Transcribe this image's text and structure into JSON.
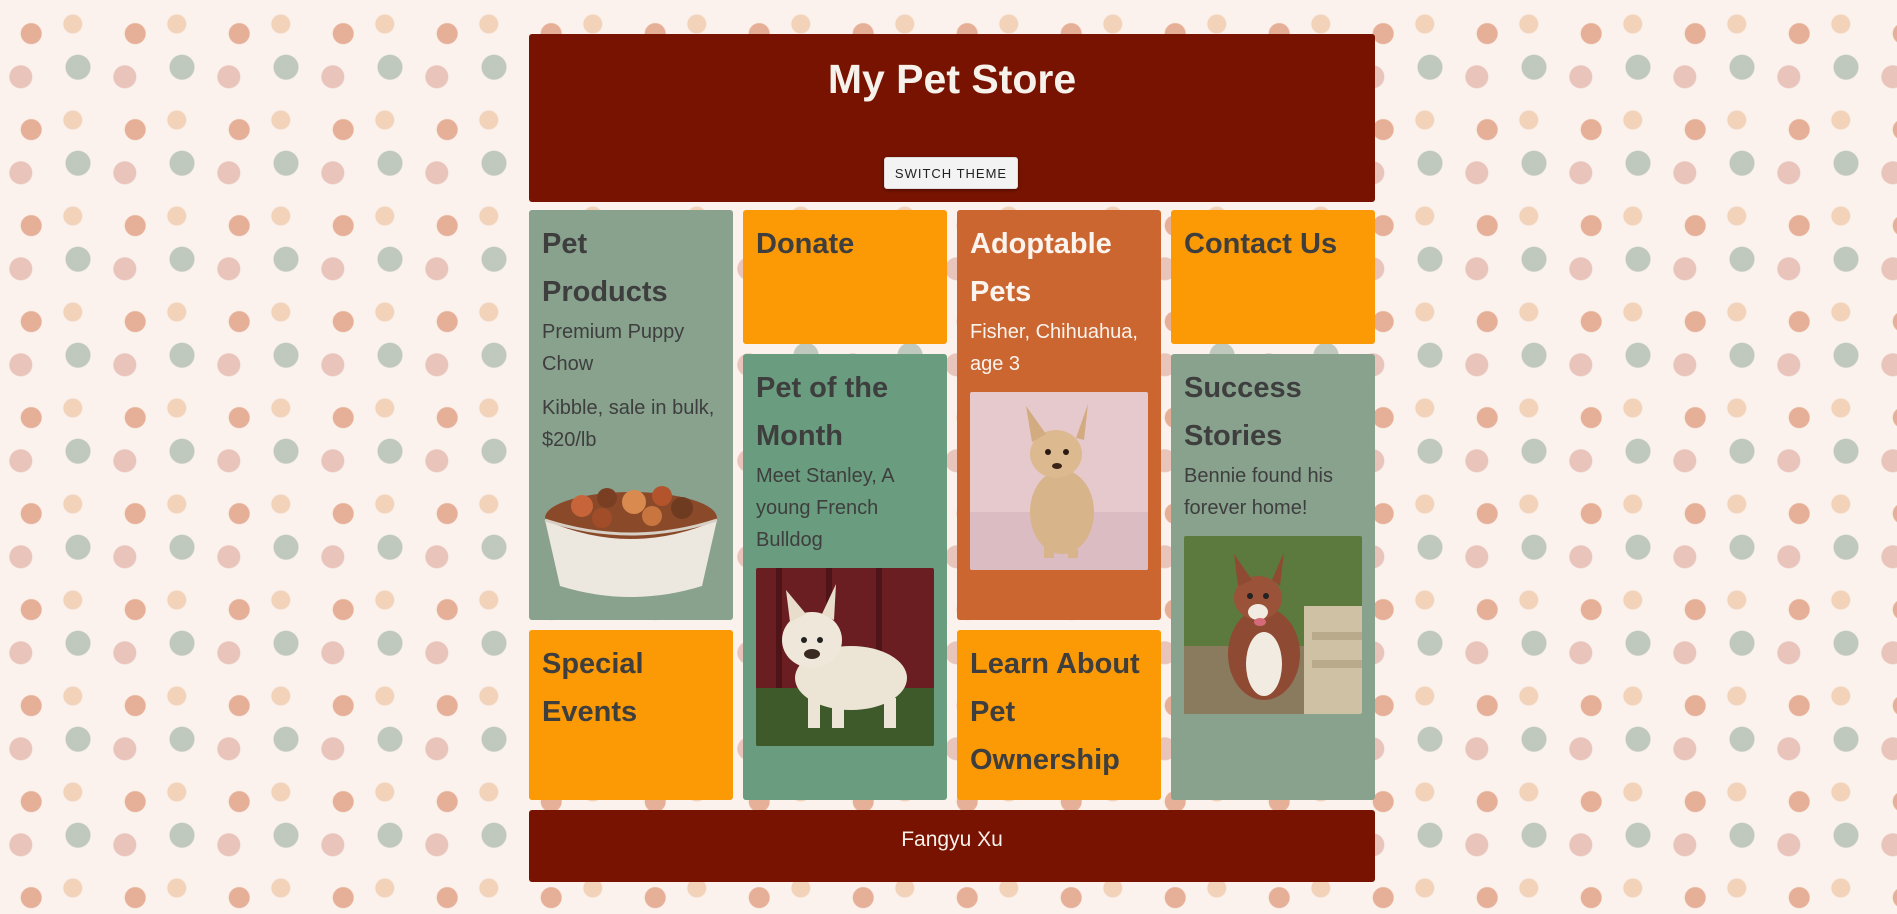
{
  "header": {
    "title": "My Pet Store",
    "theme_button": "SWITCH THEME"
  },
  "cards": {
    "pet_products": {
      "title": "Pet Products",
      "line1": "Premium Puppy Chow",
      "line2": "Kibble, sale in bulk, $20/lb",
      "image": "dog-food-bowl"
    },
    "donate": {
      "title": "Donate"
    },
    "adoptable": {
      "title": "Adoptable Pets",
      "line1": "Fisher, Chihuahua, age 3",
      "image": "chihuahua-photo"
    },
    "contact": {
      "title": "Contact Us"
    },
    "pet_of_month": {
      "title": "Pet of the Month",
      "line1": "Meet Stanley, A young French Bulldog",
      "image": "french-bulldog-photo"
    },
    "success": {
      "title": "Success Stories",
      "line1": "Bennie found his forever home!",
      "image": "collie-photo"
    },
    "special_events": {
      "title": "Special Events"
    },
    "learn": {
      "title": "Learn About Pet Ownership"
    }
  },
  "footer": {
    "text": "Fangyu Xu"
  },
  "colors": {
    "brand": "#771300",
    "orange": "#fb9a05",
    "sage": "#88a28e",
    "green": "#6a9c7f",
    "rust": "#cb6631"
  }
}
